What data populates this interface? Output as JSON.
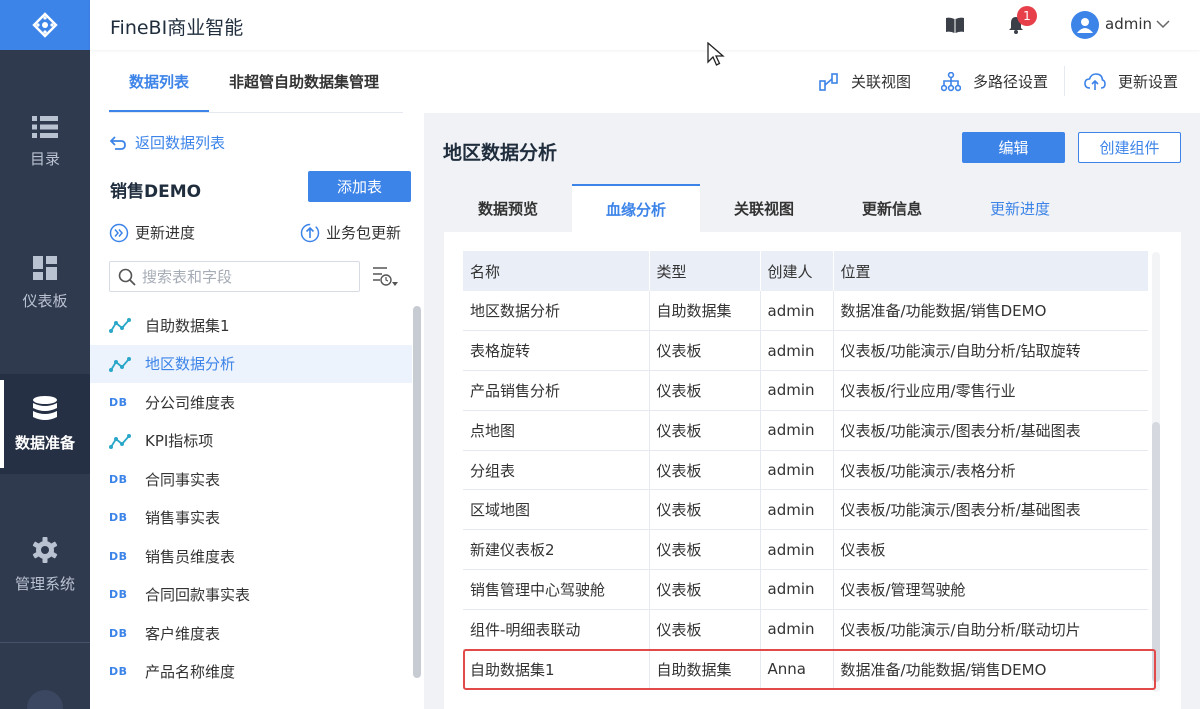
{
  "app": {
    "title": "FineBI商业智能",
    "username": "admin",
    "notification_count": "1"
  },
  "nav": {
    "items": [
      {
        "label": "目录",
        "icon": "list-icon"
      },
      {
        "label": "仪表板",
        "icon": "dashboard-icon"
      },
      {
        "label": "数据准备",
        "icon": "database-icon"
      },
      {
        "label": "管理系统",
        "icon": "gear-icon"
      }
    ],
    "active": "数据准备"
  },
  "top_tabs": [
    {
      "label": "数据列表",
      "active": true
    },
    {
      "label": "非超管自助数据集管理",
      "active": false
    }
  ],
  "top_actions": [
    {
      "label": "关联视图",
      "icon": "relation-view-icon"
    },
    {
      "label": "多路径设置",
      "icon": "multipath-icon"
    },
    {
      "label": "更新设置",
      "icon": "cloud-refresh-icon"
    }
  ],
  "left": {
    "back_label": "返回数据列表",
    "package_title": "销售DEMO",
    "add_table_label": "添加表",
    "update_progress_label": "更新进度",
    "package_update_label": "业务包更新",
    "search_placeholder": "搜索表和字段",
    "items": [
      {
        "label": "自助数据集1",
        "type": "self-service"
      },
      {
        "label": "地区数据分析",
        "type": "self-service",
        "selected": true
      },
      {
        "label": "分公司维度表",
        "type": "db"
      },
      {
        "label": "KPI指标项",
        "type": "self-service"
      },
      {
        "label": "合同事实表",
        "type": "db"
      },
      {
        "label": "销售事实表",
        "type": "db"
      },
      {
        "label": "销售员维度表",
        "type": "db"
      },
      {
        "label": "合同回款事实表",
        "type": "db"
      },
      {
        "label": "客户维度表",
        "type": "db"
      },
      {
        "label": "产品名称维度",
        "type": "db"
      }
    ],
    "db_tag": "DB"
  },
  "right": {
    "title": "地区数据分析",
    "edit_label": "编辑",
    "create_component_label": "创建组件",
    "tabs": [
      {
        "label": "数据预览"
      },
      {
        "label": "血缘分析",
        "active": true
      },
      {
        "label": "关联视图"
      },
      {
        "label": "更新信息"
      },
      {
        "label": "更新进度"
      }
    ],
    "table": {
      "headers": [
        "名称",
        "类型",
        "创建人",
        "位置"
      ],
      "rows": [
        [
          "地区数据分析",
          "自助数据集",
          "admin",
          "数据准备/功能数据/销售DEMO"
        ],
        [
          "表格旋转",
          "仪表板",
          "admin",
          "仪表板/功能演示/自助分析/钻取旋转"
        ],
        [
          "产品销售分析",
          "仪表板",
          "admin",
          "仪表板/行业应用/零售行业"
        ],
        [
          "点地图",
          "仪表板",
          "admin",
          "仪表板/功能演示/图表分析/基础图表"
        ],
        [
          "分组表",
          "仪表板",
          "admin",
          "仪表板/功能演示/表格分析"
        ],
        [
          "区域地图",
          "仪表板",
          "admin",
          "仪表板/功能演示/图表分析/基础图表"
        ],
        [
          "新建仪表板2",
          "仪表板",
          "admin",
          "仪表板"
        ],
        [
          "销售管理中心驾驶舱",
          "仪表板",
          "admin",
          "仪表板/管理驾驶舱"
        ],
        [
          "组件-明细表联动",
          "仪表板",
          "admin",
          "仪表板/功能演示/自助分析/联动切片"
        ],
        [
          "自助数据集1",
          "自助数据集",
          "Anna",
          "数据准备/功能数据/销售DEMO"
        ]
      ]
    }
  },
  "colors": {
    "accent": "#3d84e8",
    "nav_bg": "#2f3a4f",
    "highlight": "#e24a4a"
  }
}
